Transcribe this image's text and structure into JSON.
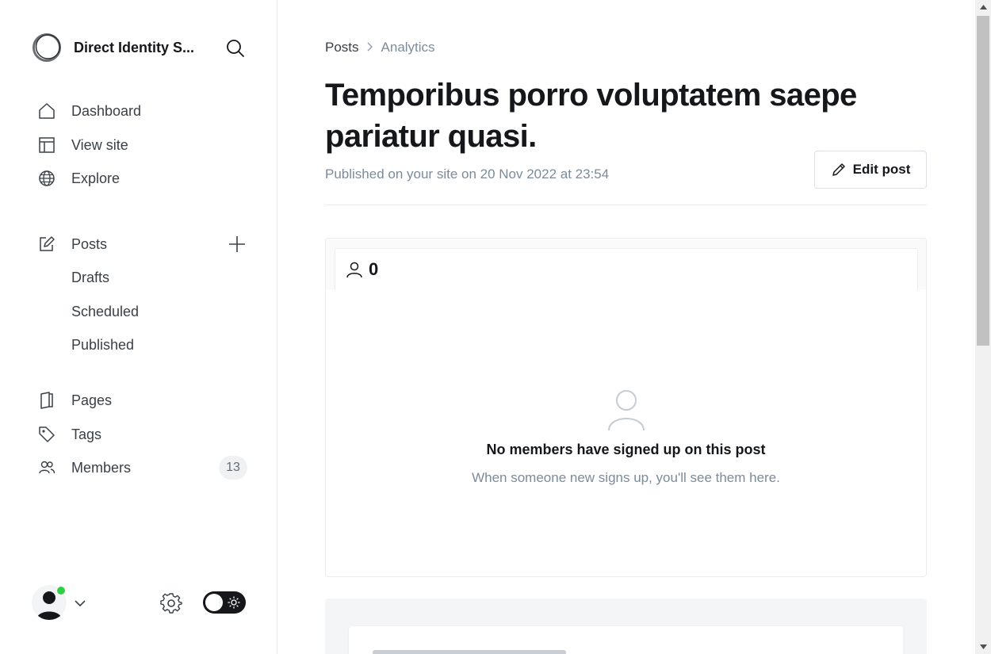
{
  "brand": {
    "name": "Direct Identity S...",
    "logo_icon": "circle-logo-icon",
    "search_icon": "search-icon"
  },
  "nav": {
    "primary": [
      {
        "label": "Dashboard",
        "icon": "home-icon"
      },
      {
        "label": "View site",
        "icon": "layout-icon"
      },
      {
        "label": "Explore",
        "icon": "globe-icon"
      }
    ],
    "posts": {
      "label": "Posts",
      "icon": "pencil-square-icon",
      "add_icon": "plus-icon"
    },
    "post_subitems": [
      "Drafts",
      "Scheduled",
      "Published"
    ],
    "secondary": [
      {
        "label": "Pages",
        "icon": "page-icon"
      },
      {
        "label": "Tags",
        "icon": "tag-icon"
      },
      {
        "label": "Members",
        "icon": "members-icon",
        "badge": "13"
      }
    ]
  },
  "footer": {
    "status_color": "#30cf43",
    "theme_toggle": "dark"
  },
  "breadcrumb": {
    "parent": "Posts",
    "separator": ">",
    "current": "Analytics"
  },
  "post": {
    "title": "Temporibus porro voluptatem saepe pariatur quasi.",
    "meta": "Published on your site on 20 Nov 2022 at 23:54",
    "edit_label": "Edit post"
  },
  "members_card": {
    "count": "0",
    "empty_title": "No members have signed up on this post",
    "empty_subtitle": "When someone new signs up, you'll see them here."
  },
  "colors": {
    "text": "#15171a",
    "muted": "#7c8b9a",
    "accent_online": "#30cf43"
  }
}
